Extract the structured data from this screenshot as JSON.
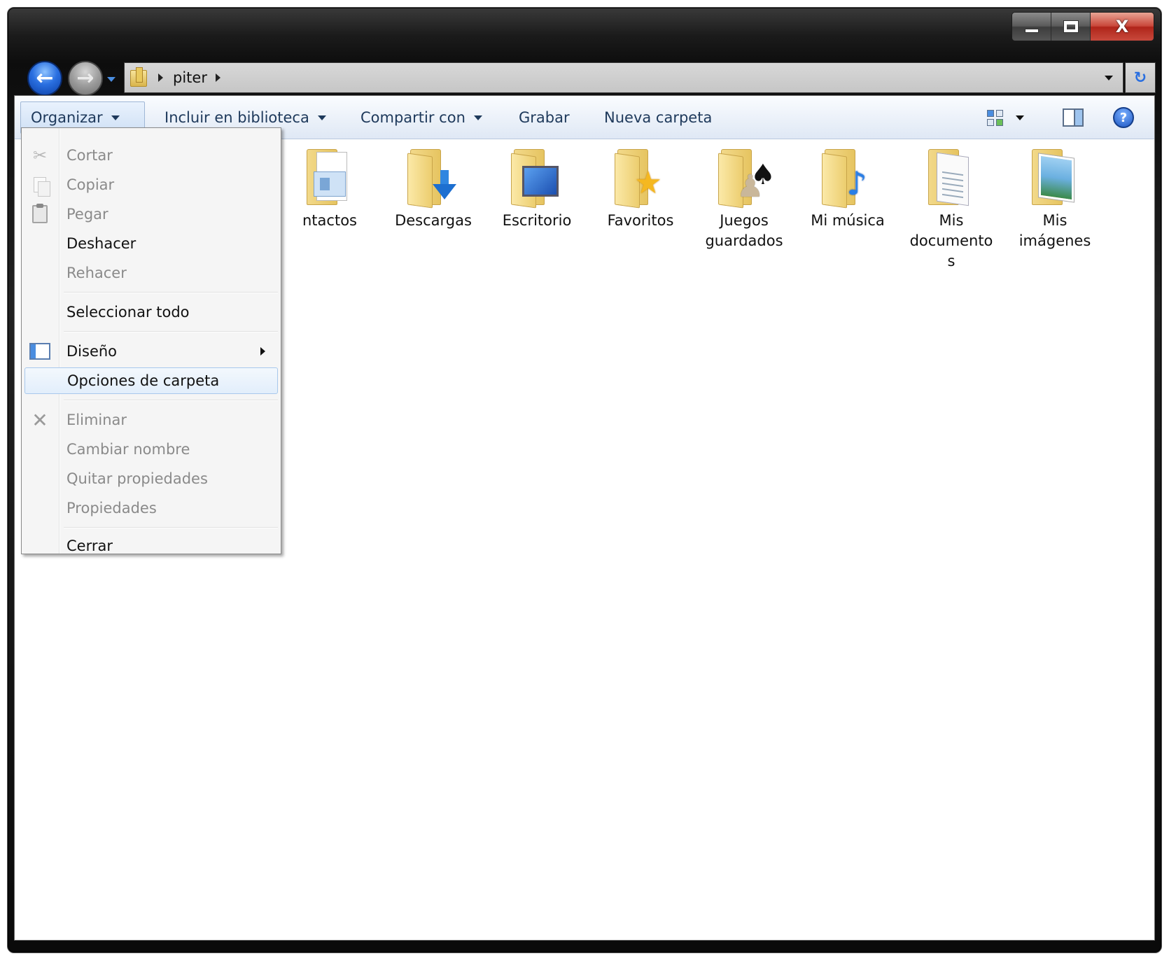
{
  "window": {
    "caption_close": "X"
  },
  "nav": {
    "back_glyph": "←",
    "forward_glyph": "→",
    "refresh_glyph": "↻"
  },
  "address": {
    "crumbs": [
      "piter"
    ]
  },
  "toolbar": {
    "organize": "Organizar",
    "include_library": "Incluir en biblioteca",
    "share_with": "Compartir con",
    "burn": "Grabar",
    "new_folder": "Nueva carpeta",
    "help_glyph": "?"
  },
  "folders": [
    {
      "label": "Contactos",
      "visible_label": "ntactos",
      "badge": "contact-card-icon"
    },
    {
      "label": "Descargas",
      "badge": "download-arrow-icon"
    },
    {
      "label": "Escritorio",
      "badge": "desktop-icon"
    },
    {
      "label": "Favoritos",
      "badge": "star-icon"
    },
    {
      "label": "Juegos guardados",
      "line1": "Juegos",
      "line2": "guardados",
      "badge": "chess-icon"
    },
    {
      "label": "Mi música",
      "badge": "music-note-icon"
    },
    {
      "label": "Mis documentos",
      "line1": "Mis",
      "line2": "documento",
      "line3": "s",
      "badge": "document-icon"
    },
    {
      "label": "Mis imágenes",
      "line1": "Mis",
      "line2": "imágenes",
      "badge": "picture-icon"
    }
  ],
  "menu": {
    "cut": "Cortar",
    "copy": "Copiar",
    "paste": "Pegar",
    "undo": "Deshacer",
    "redo": "Rehacer",
    "select_all": "Seleccionar todo",
    "layout": "Diseño",
    "folder_options": "Opciones de carpeta",
    "delete": "Eliminar",
    "rename": "Cambiar nombre",
    "remove_properties": "Quitar propiedades",
    "properties": "Propiedades",
    "close": "Cerrar"
  },
  "colors": {
    "toolbar_text": "#1e395b",
    "menu_hover_border": "#a8c8ec",
    "folder_yellow": "#f2d98a",
    "accent_blue": "#4a8de0"
  }
}
